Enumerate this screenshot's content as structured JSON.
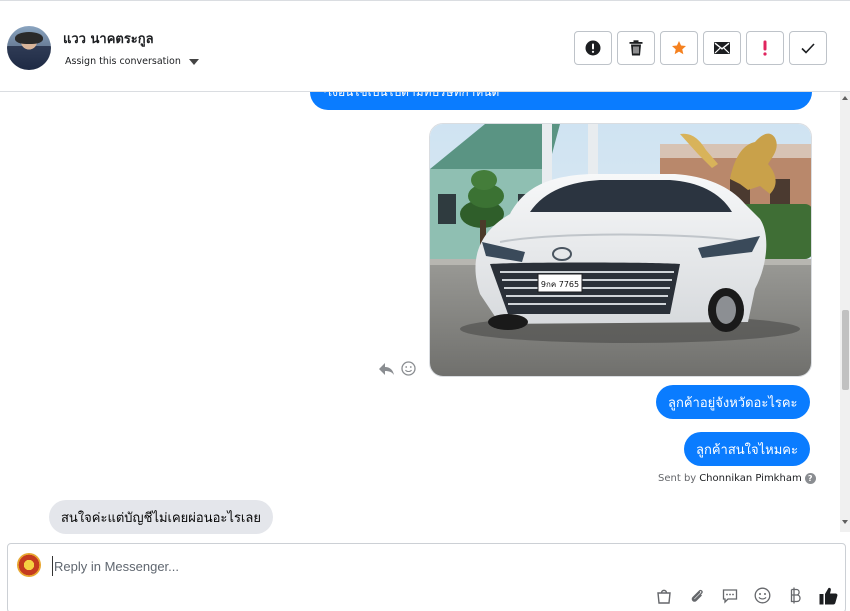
{
  "contact": {
    "name": "แวว นาคตระกูล",
    "assign_label": "Assign this conversation"
  },
  "actions": [
    {
      "name": "mark-spam",
      "icon": "exclamation-circle-icon"
    },
    {
      "name": "delete",
      "icon": "trash-icon"
    },
    {
      "name": "star",
      "icon": "star-icon",
      "color": "#f5811f"
    },
    {
      "name": "mark-unread",
      "icon": "envelope-icon"
    },
    {
      "name": "follow-up",
      "icon": "exclamation-icon",
      "color": "#e0245e"
    },
    {
      "name": "mark-done",
      "icon": "check-icon"
    }
  ],
  "messages": {
    "partial_top": "*เงื่อนไขเป็นไปตามที่บริษัทกำหนด",
    "image_plate": "9กค 7765",
    "outgoing_1": "ลูกค้าอยู่จังหวัดอะไรคะ",
    "outgoing_2": "ลูกค้าสนใจไหมคะ",
    "sent_by_prefix": "Sent by",
    "sent_by_name": "Chonnikan Pimkham",
    "incoming_1": "สนใจค่ะแต่บัญชีไม่เคยผ่อนอะไรเลย"
  },
  "composer": {
    "placeholder": "Reply in Messenger..."
  },
  "colors": {
    "outgoing_bubble": "#0a7cff",
    "incoming_bubble": "#e4e6eb"
  }
}
